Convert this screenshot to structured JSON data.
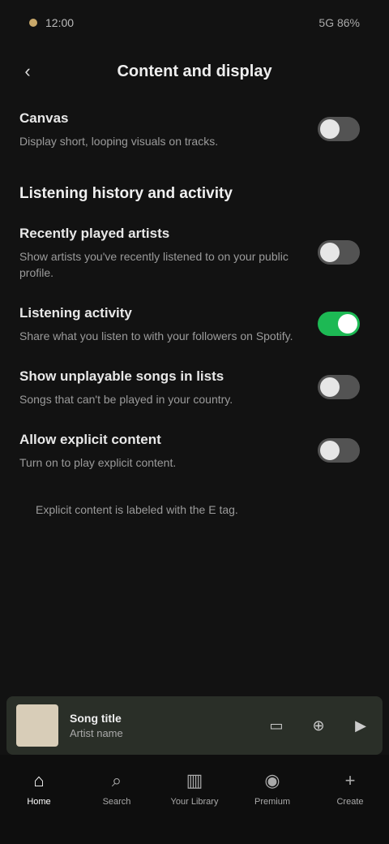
{
  "status_bar": {
    "time": "12:00",
    "right": "5G 86%"
  },
  "topbar": {
    "title": "Content and display"
  },
  "rows": [
    {
      "title": "Canvas",
      "desc": "Display short, looping visuals on tracks.",
      "on": false
    }
  ],
  "section": {
    "title": "Listening history and activity"
  },
  "settings": [
    {
      "title": "Recently played artists",
      "desc": "Show artists you've recently listened to on your public profile.",
      "on": false
    },
    {
      "title": "Listening activity",
      "desc": "Share what you listen to with your followers on Spotify.",
      "on": true
    },
    {
      "title": "Show unplayable songs in lists",
      "desc": "Songs that can't be played in your country.",
      "on": false
    },
    {
      "title": "Allow explicit content",
      "desc": "Turn on to play explicit content.",
      "on": false
    }
  ],
  "note": "Explicit content is labeled with the E tag.",
  "now_playing": {
    "title": "Song title",
    "artist": "Artist name"
  },
  "nav": [
    {
      "label": "Home",
      "icon": "⌂"
    },
    {
      "label": "Search",
      "icon": "⌕"
    },
    {
      "label": "Your Library",
      "icon": "▥"
    },
    {
      "label": "Premium",
      "icon": "◉"
    },
    {
      "label": "Create",
      "icon": "+"
    }
  ]
}
